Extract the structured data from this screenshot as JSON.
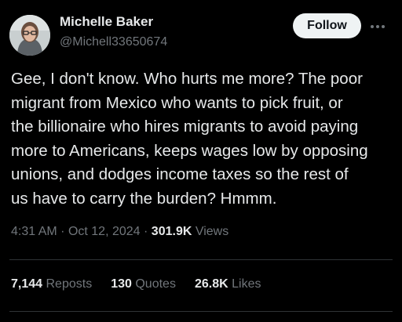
{
  "author": {
    "display_name": "Michelle Baker",
    "handle": "@Michell33650674"
  },
  "actions": {
    "follow_label": "Follow",
    "more_icon": "more-horizontal-icon"
  },
  "tweet": {
    "lines": [
      "Gee, I don't know.  Who hurts me more?  The poor",
      "migrant from Mexico who wants to pick fruit, or",
      "the billionaire who hires migrants to avoid paying",
      "more to Americans, keeps wages low by opposing",
      "unions, and dodges income taxes so the rest of",
      "us have to carry the burden?  Hmmm."
    ]
  },
  "meta": {
    "time": "4:31 AM",
    "separator": "·",
    "date": "Oct 12, 2024",
    "views_count": "301.9K",
    "views_label": "Views"
  },
  "stats": {
    "reposts_count": "7,144",
    "reposts_label": "Reposts",
    "quotes_count": "130",
    "quotes_label": "Quotes",
    "likes_count": "26.8K",
    "likes_label": "Likes"
  },
  "colors": {
    "background": "#000000",
    "primary_text": "#e7e9ea",
    "secondary_text": "#71767b",
    "follow_button_bg": "#eff3f4"
  }
}
